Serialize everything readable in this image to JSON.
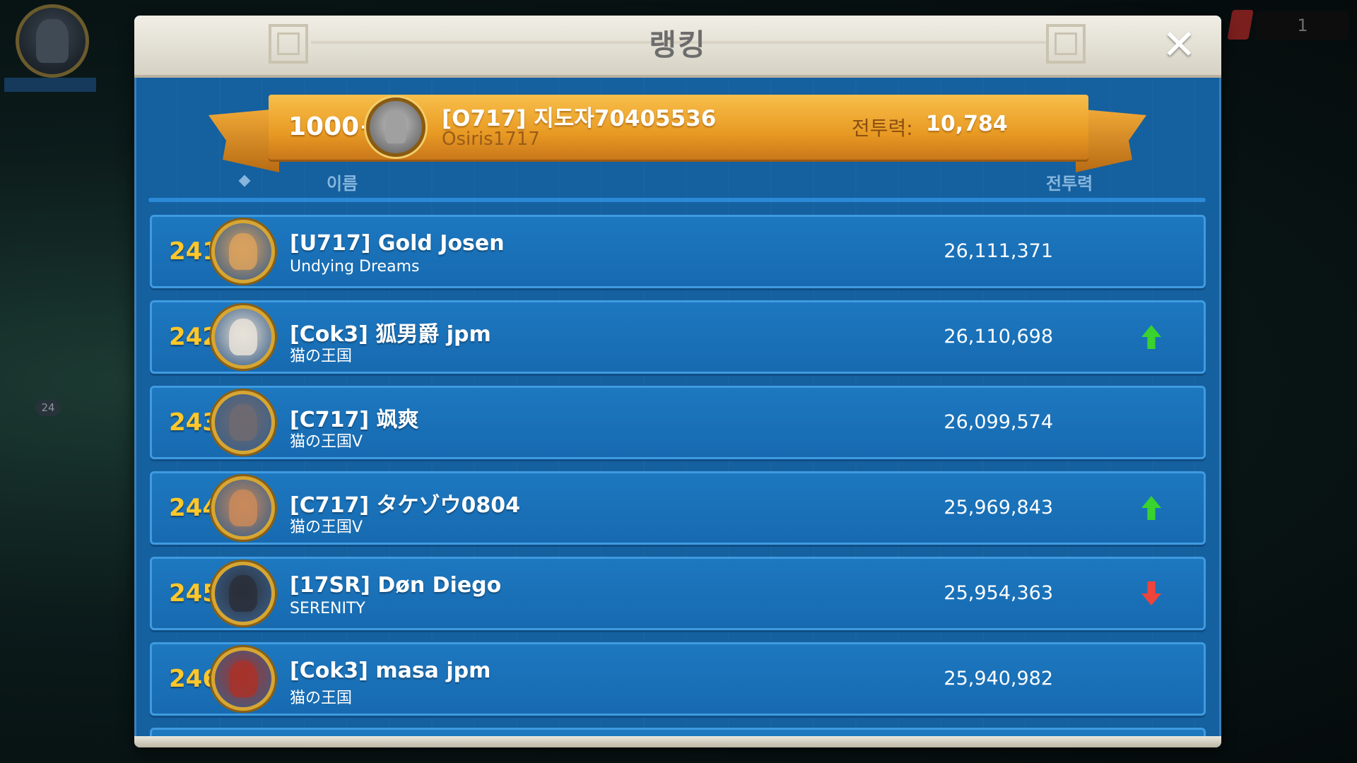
{
  "background": {
    "side_badge_count": "24",
    "top_right_counter": "1"
  },
  "panel": {
    "title": "랭킹",
    "close_symbol": "✕"
  },
  "my_rank": {
    "rank": "1000+",
    "name": "[O717] 지도자70405536",
    "alliance": "Osiris1717",
    "power_label": "전투력:",
    "power_value": "10,784"
  },
  "columns": {
    "name": "이름",
    "power": "전투력"
  },
  "colors": {
    "rank_number": "#ffc72a",
    "row_bg": "#1d78c0",
    "banner": "#e89a23",
    "trend_up": "#39d22f",
    "trend_down": "#f0433a"
  },
  "rows": [
    {
      "rank": "241",
      "name": "[U717] Gold Josen",
      "alliance": "Undying Dreams",
      "power": "26,111,371",
      "trend": "none",
      "avatar": "muscle-man-portrait",
      "avatar_color": "#d9a15e"
    },
    {
      "rank": "242",
      "name": "[Cok3] 狐男爵 jpm",
      "alliance": "猫の王国",
      "power": "26,110,698",
      "trend": "up",
      "avatar": "white-horse-portrait",
      "avatar_color": "#e8e2d8"
    },
    {
      "rank": "243",
      "name": "[C717] 飒爽",
      "alliance": "猫の王国V",
      "power": "26,099,574",
      "trend": "none",
      "avatar": "castle-portrait",
      "avatar_color": "#6e6a70"
    },
    {
      "rank": "244",
      "name": "[C717] タケゾウ0804",
      "alliance": "猫の王国V",
      "power": "25,969,843",
      "trend": "up",
      "avatar": "warrior-face-portrait",
      "avatar_color": "#c98a5a"
    },
    {
      "rank": "245",
      "name": "[17SR] Døn Diego",
      "alliance": "SERENITY",
      "power": "25,954,363",
      "trend": "down",
      "avatar": "dark-rider-portrait",
      "avatar_color": "#2a2f3a"
    },
    {
      "rank": "246",
      "name": "[Cok3] masa jpm",
      "alliance": "猫の王国",
      "power": "25,940,982",
      "trend": "none",
      "avatar": "samurai-portrait",
      "avatar_color": "#a7322a"
    }
  ]
}
